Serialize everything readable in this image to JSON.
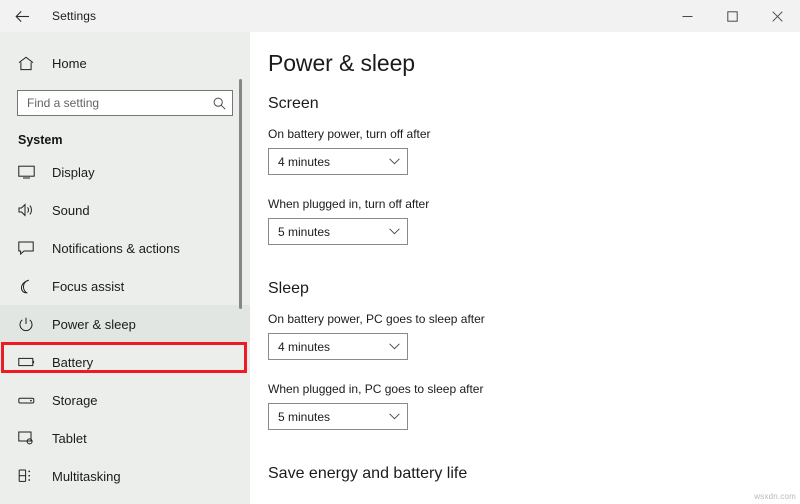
{
  "titlebar": {
    "back_icon": "back-arrow-icon",
    "title": "Settings",
    "minimize_label": "Minimize",
    "maximize_label": "Maximize",
    "close_label": "Close"
  },
  "sidebar": {
    "home": {
      "label": "Home",
      "icon": "home-icon"
    },
    "search": {
      "placeholder": "Find a setting",
      "value": "",
      "icon": "search-icon"
    },
    "group_title": "System",
    "items": [
      {
        "label": "Display",
        "icon": "monitor-icon",
        "selected": false
      },
      {
        "label": "Sound",
        "icon": "speaker-icon",
        "selected": false
      },
      {
        "label": "Notifications & actions",
        "icon": "notification-icon",
        "selected": false
      },
      {
        "label": "Focus assist",
        "icon": "moon-icon",
        "selected": false
      },
      {
        "label": "Power & sleep",
        "icon": "power-icon",
        "selected": true
      },
      {
        "label": "Battery",
        "icon": "battery-icon",
        "selected": false
      },
      {
        "label": "Storage",
        "icon": "storage-icon",
        "selected": false
      },
      {
        "label": "Tablet",
        "icon": "tablet-icon",
        "selected": false
      },
      {
        "label": "Multitasking",
        "icon": "multitasking-icon",
        "selected": false
      }
    ],
    "highlight_color": "#ee1b24"
  },
  "main": {
    "page_title": "Power & sleep",
    "screen_section": {
      "title": "Screen",
      "battery_label": "On battery power, turn off after",
      "battery_value": "4 minutes",
      "plugged_label": "When plugged in, turn off after",
      "plugged_value": "5 minutes"
    },
    "sleep_section": {
      "title": "Sleep",
      "battery_label": "On battery power, PC goes to sleep after",
      "battery_value": "4 minutes",
      "plugged_label": "When plugged in, PC goes to sleep after",
      "plugged_value": "5 minutes"
    },
    "save_energy_title": "Save energy and battery life"
  },
  "watermark": "wsxdn.com"
}
